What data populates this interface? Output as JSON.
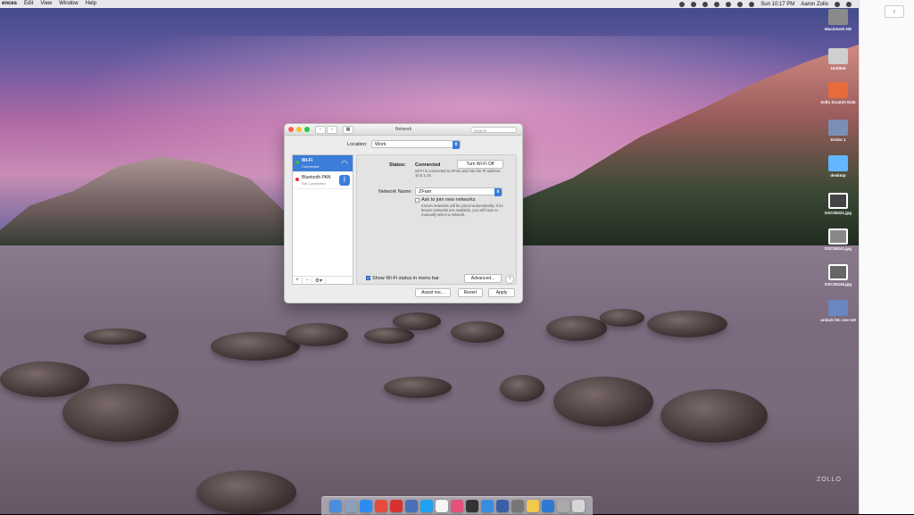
{
  "menubar": {
    "app": "ences",
    "items": [
      "Edit",
      "View",
      "Window",
      "Help"
    ],
    "clock": "Sun 10:17 PM",
    "user": "Aaron Zollo"
  },
  "right_panel": {
    "back": "‹"
  },
  "desktop_icons": [
    {
      "label": "Macintosh HD",
      "icon": "hard-drive-icon",
      "color": "#8a8a8a"
    },
    {
      "label": "Untitled",
      "icon": "drive-icon",
      "color": "#cfcfcf"
    },
    {
      "label": "Zollo Scratch Disk",
      "icon": "external-drive-icon",
      "color": "#e76b3c"
    },
    {
      "label": "Drobo 1",
      "icon": "network-drive-icon",
      "color": "#7b8fb6"
    },
    {
      "label": "desktop",
      "icon": "folder-icon",
      "color": "#63b6ff"
    },
    {
      "label": "DSC05221.jpg",
      "icon": "image-file-icon",
      "color": "#444"
    },
    {
      "label": "DSC05241.jpg",
      "icon": "image-file-icon",
      "color": "#888"
    },
    {
      "label": "DSC05249.jpg",
      "icon": "image-file-icon",
      "color": "#666"
    },
    {
      "label": "unlock htc one m9",
      "icon": "document-icon",
      "color": "#6a87c2"
    }
  ],
  "window": {
    "title": "Network",
    "search_placeholder": "Search",
    "location_label": "Location:",
    "location_value": "Work",
    "services": [
      {
        "name": "Wi-Fi",
        "status": "Connected",
        "dot": "#3fb84a",
        "icon": "wifi-icon",
        "selected": true
      },
      {
        "name": "Bluetooth PAN",
        "status": "Not Connected",
        "dot": "#e0322f",
        "icon": "bluetooth-icon",
        "selected": false
      }
    ],
    "footer": [
      "+",
      "−",
      "⚙▾"
    ],
    "status_label": "Status:",
    "status_value": "Connected",
    "turn_off": "Turn Wi-Fi Off",
    "status_desc": "Wi-Fi is connected to ZFam and has the IP address 10.0.1.15.",
    "network_name_label": "Network Name:",
    "network_name_value": "ZFam",
    "ask_label": "Ask to join new networks",
    "ask_desc": "Known networks will be joined automatically. If no known networks are available, you will have to manually select a network.",
    "show_status_label": "Show Wi-Fi status in menu bar",
    "advanced": "Advanced...",
    "help": "?",
    "assist": "Assist me...",
    "revert": "Revert",
    "apply": "Apply"
  },
  "dock": {
    "apps": [
      {
        "icon": "finder-icon",
        "color": "#4c8edb"
      },
      {
        "icon": "launchpad-icon",
        "color": "#8ea0b8"
      },
      {
        "icon": "safari-icon",
        "color": "#2d8cf0"
      },
      {
        "icon": "chrome-icon",
        "color": "#e44c3d"
      },
      {
        "icon": "opera-icon",
        "color": "#d8322f"
      },
      {
        "icon": "photos-icon",
        "color": "#4a6fb6"
      },
      {
        "icon": "twitter-icon",
        "color": "#1da1f2"
      },
      {
        "icon": "calendar-icon",
        "color": "#f5f5f5"
      },
      {
        "icon": "itunes-icon",
        "color": "#e5527a"
      },
      {
        "icon": "photo-booth-icon",
        "color": "#333"
      },
      {
        "icon": "app-store-icon",
        "color": "#3a8de0"
      },
      {
        "icon": "xcode-icon",
        "color": "#3a5fa8"
      },
      {
        "icon": "system-preferences-icon",
        "color": "#777"
      },
      {
        "icon": "photos-app-icon",
        "color": "#f2c94c"
      },
      {
        "icon": "browser-icon",
        "color": "#2e7ad1"
      },
      {
        "icon": "downloads-stack-icon",
        "color": "#aaaaaa"
      },
      {
        "icon": "trash-icon",
        "color": "#d6d6d6"
      }
    ]
  },
  "watermark": "ZOLLO"
}
